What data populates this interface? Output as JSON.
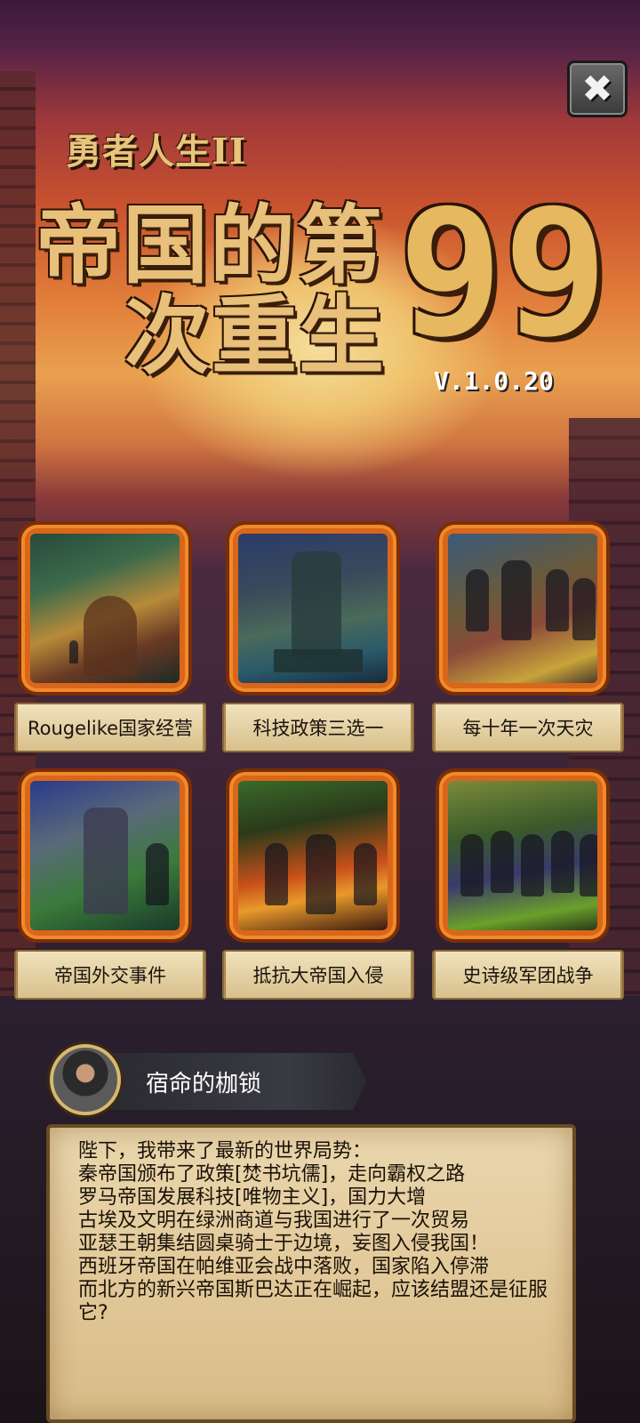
{
  "header": {
    "subtitle": "勇者人生II",
    "title_line1": "帝国的第",
    "title_line2": "次重生",
    "title_number": "99",
    "version": "V.1.0.20"
  },
  "close_button": {
    "label": "✖"
  },
  "features": [
    {
      "label": "Rougelike国家经营",
      "icon": "town-illustration"
    },
    {
      "label": "科技政策三选一",
      "icon": "statue-illustration"
    },
    {
      "label": "每十年一次天灾",
      "icon": "knights-battle-illustration"
    },
    {
      "label": "帝国外交事件",
      "icon": "knight-warrior-illustration"
    },
    {
      "label": "抵抗大帝国入侵",
      "icon": "burning-street-illustration"
    },
    {
      "label": "史诗级军团战争",
      "icon": "army-march-illustration"
    }
  ],
  "speaker": {
    "name": "宿命的枷锁"
  },
  "dialog": {
    "lines": [
      "陛下，我带来了最新的世界局势：",
      "秦帝国颁布了政策[焚书坑儒]，走向霸权之路",
      "罗马帝国发展科技[唯物主义]，国力大增",
      "古埃及文明在绿洲商道与我国进行了一次贸易",
      "亚瑟王朝集结圆桌骑士于边境，妄图入侵我国！",
      "西班牙帝国在帕维亚会战中落败，国家陷入停滞",
      "而北方的新兴帝国斯巴达正在崛起，应该结盟还是征服它?"
    ]
  },
  "colors": {
    "frame_orange": "#d9661a",
    "title_gold": "#e8c07a",
    "parchment": "#e2c99a"
  }
}
